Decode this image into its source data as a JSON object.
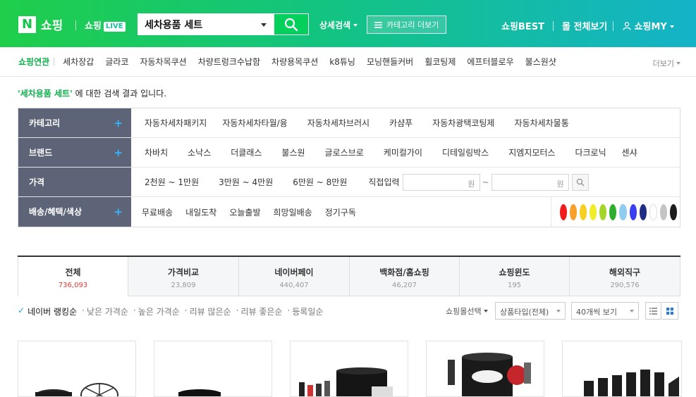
{
  "header": {
    "logo_n": "N",
    "logo_shopping": "쇼핑",
    "live_text": "쇼핑",
    "live_tag": "LIVE",
    "search_value": "세차용품 세트",
    "advanced_search": "상세검색",
    "category_button": "카테고리 더보기",
    "shopping_best": "쇼핑BEST",
    "mall_all": "몰 전체보기",
    "my_shopping": "쇼핑MY"
  },
  "related": {
    "title": "쇼핑연관",
    "items": [
      "세차장갑",
      "글라코",
      "자동차목쿠션",
      "차량트렁크수납함",
      "차량용목쿠션",
      "k8튜닝",
      "모닝핸들커버",
      "휠코팅제",
      "에프터블로우",
      "불스원샷"
    ],
    "more": "더보기"
  },
  "result": {
    "query": "'세차용품 세트'",
    "suffix": " 에 대한 검색 결과 입니다."
  },
  "filters": {
    "category": {
      "label": "카테고리",
      "items": [
        "자동차세차패키지",
        "자동차세차타월/융",
        "자동차세차브러시",
        "카샴푸",
        "자동차광택코팅제",
        "자동차세차물통"
      ]
    },
    "brand": {
      "label": "브랜드",
      "items": [
        "차바치",
        "소낙스",
        "더클래스",
        "불스원",
        "글로스브로",
        "케미컬가이",
        "디테일링박스",
        "지엠지모터스",
        "다크로닉",
        "센샤"
      ]
    },
    "price": {
      "label": "가격",
      "ranges": [
        "2천원 ~ 1만원",
        "3만원 ~ 4만원",
        "6만원 ~ 8만원"
      ],
      "direct": "직접입력",
      "unit": "원",
      "tilde": "~"
    },
    "delivery": {
      "label": "배송/혜택/색상",
      "items": [
        "무료배송",
        "내일도착",
        "오늘출발",
        "희망일배송",
        "정기구독"
      ]
    },
    "plus": "+",
    "colors": [
      "#f01b1b",
      "#f7a02b",
      "#f7cf21",
      "#f0ee2a",
      "#a6d52a",
      "#2fad2f",
      "#90cdf0",
      "#3b3ff2",
      "#1f2d85",
      "#ffffff",
      "#c4c4c4",
      "#1c1c1c"
    ]
  },
  "tabs": [
    {
      "label": "전체",
      "count": "736,093"
    },
    {
      "label": "가격비교",
      "count": "23,809"
    },
    {
      "label": "네이버페이",
      "count": "440,407"
    },
    {
      "label": "백화점/홈쇼핑",
      "count": "46,207"
    },
    {
      "label": "쇼핑윈도",
      "count": "195"
    },
    {
      "label": "해외직구",
      "count": "290,576"
    }
  ],
  "sort": {
    "check": "✓",
    "items": [
      "네이버 랭킹순",
      "낮은 가격순",
      "높은 가격순",
      "리뷰 많은순",
      "리뷰 좋은순",
      "등록일순"
    ],
    "bullet": "·",
    "mall_select": "쇼핑몰선택",
    "product_type": "상품타입(전체)",
    "per_page": "40개씩 보기"
  }
}
